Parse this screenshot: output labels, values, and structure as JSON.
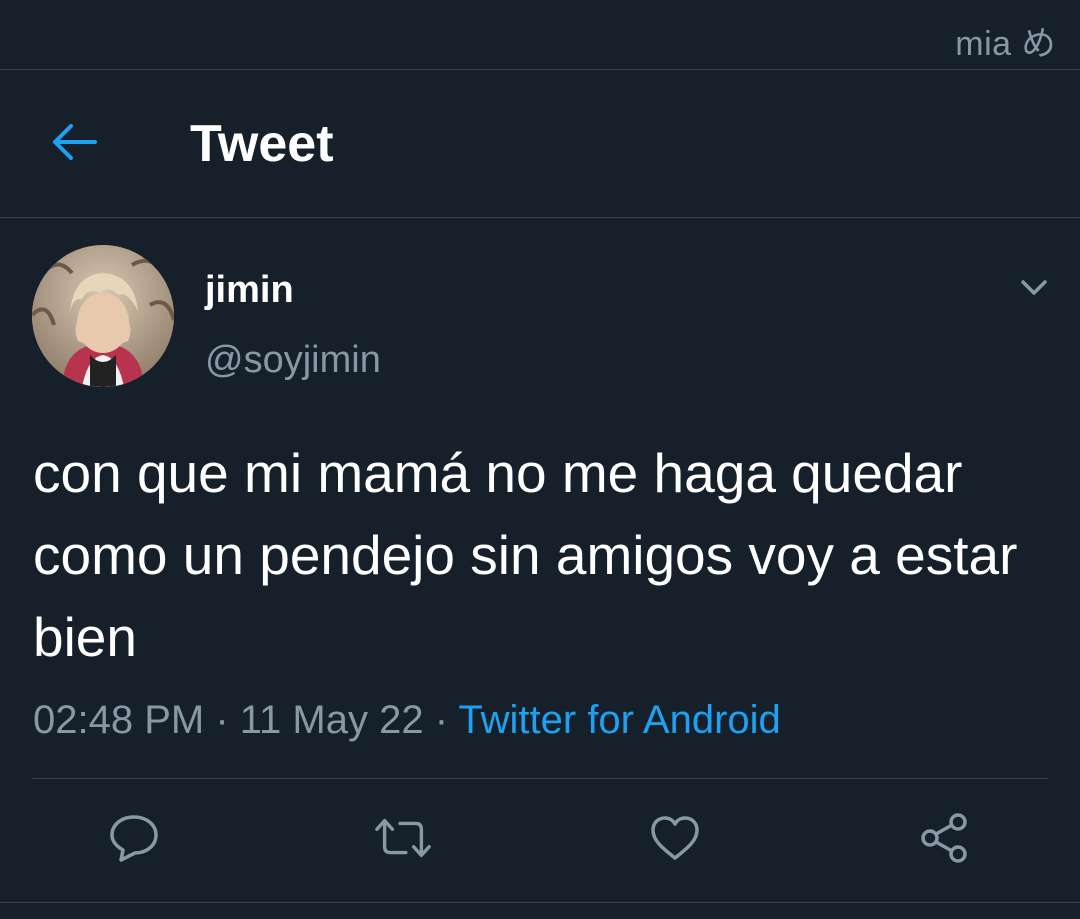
{
  "status_bar": {
    "watermark": "mia め"
  },
  "header": {
    "back_icon": "arrow-left-icon",
    "title": "Tweet"
  },
  "tweet": {
    "author": {
      "display_name": "jimin",
      "handle": "@soyjimin",
      "avatar_icon": "avatar-photo"
    },
    "more_icon": "chevron-down-icon",
    "text": "con que mi mamá no me haga quedar como un pendejo sin amigos voy a estar bien",
    "time": "02:48 PM",
    "separator": " · ",
    "date": "11 May 22",
    "source": "Twitter for Android",
    "actions": [
      {
        "icon": "reply-icon"
      },
      {
        "icon": "retweet-icon"
      },
      {
        "icon": "like-icon"
      },
      {
        "icon": "share-icon"
      }
    ]
  },
  "colors": {
    "background": "#15202b",
    "accent": "#1da1f2",
    "secondary_text": "#8899a6",
    "divider": "#38444d"
  }
}
